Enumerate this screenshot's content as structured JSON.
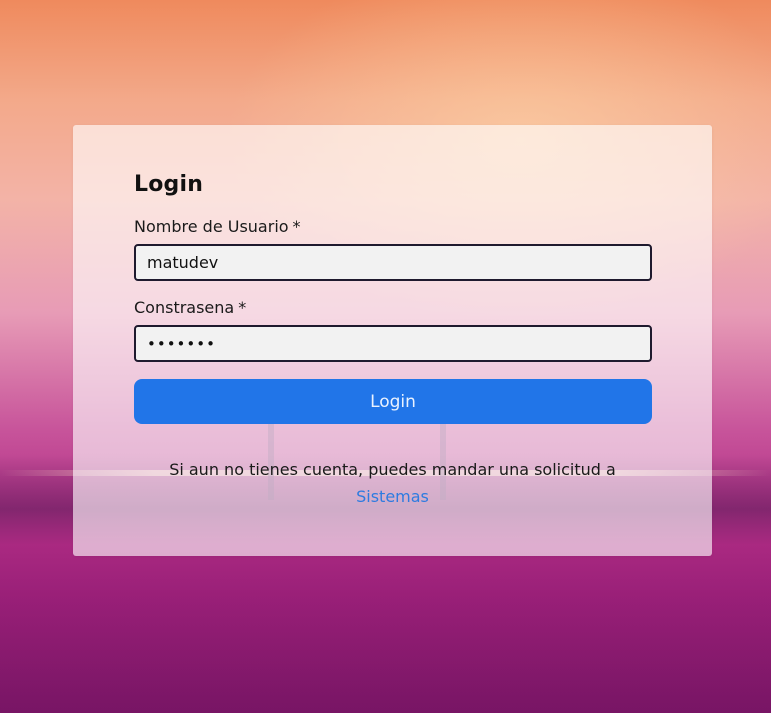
{
  "colors": {
    "accent": "#2175e8",
    "link": "#2e7be0",
    "field_border": "#1f1a2e"
  },
  "login": {
    "title": "Login",
    "username_label": "Nombre de Usuario",
    "username_required": "*",
    "username_value": "matudev",
    "password_label": "Constrasena",
    "password_required": "*",
    "password_masked": "•••••••",
    "submit_label": "Login",
    "note_text": "Si aun no tienes cuenta, puedes mandar una solicitud a",
    "note_link": "Sistemas"
  }
}
